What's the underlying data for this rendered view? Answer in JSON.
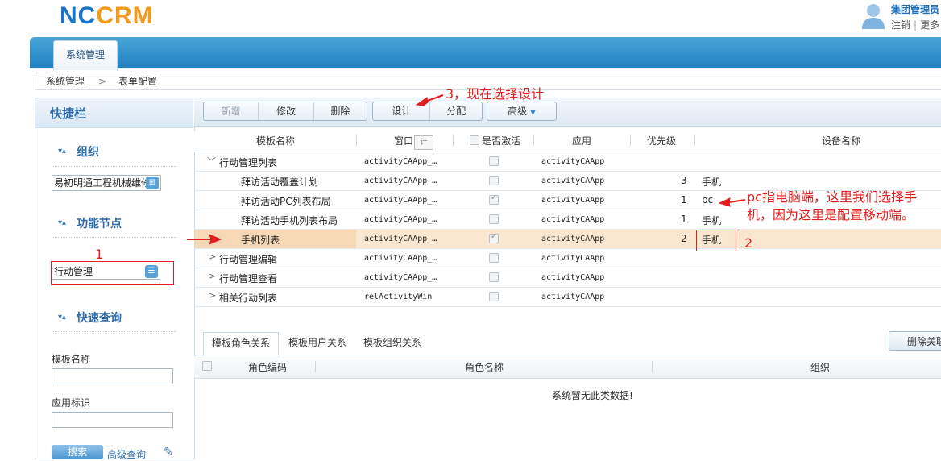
{
  "header": {
    "logo_nc": "NC",
    "logo_crm": "CRM",
    "user_name": "集团管理员",
    "logout": "注销",
    "more": "更多"
  },
  "nav": {
    "tab": "系统管理"
  },
  "breadcrumb": {
    "level1": "系统管理",
    "separator": ">",
    "level2": "表单配置"
  },
  "sidebar": {
    "title": "快捷栏",
    "org": {
      "title": "组织",
      "value": "易初明通工程机械维修"
    },
    "func": {
      "title": "功能节点",
      "value": "行动管理"
    },
    "query": {
      "title": "快速查询",
      "template_label": "模板名称",
      "app_label": "应用标识",
      "search_button": "搜索",
      "advanced_link": "高级查询"
    }
  },
  "toolbar": {
    "new": "新增",
    "edit": "修改",
    "delete": "删除",
    "design": "设计",
    "assign": "分配",
    "advanced": "高级"
  },
  "grid": {
    "headers": {
      "name": "模板名称",
      "window": "窗口",
      "active": "是否激活",
      "app": "应用",
      "priority": "优先级",
      "device": "设备名称"
    },
    "window_tooltip": "计",
    "rows": [
      {
        "name": "行动管理列表",
        "window": "activityCAApp_…",
        "active": false,
        "app": "activityCAApp",
        "priority": "",
        "device": "",
        "expand": "﹀",
        "level": 0
      },
      {
        "name": "拜访活动覆盖计划",
        "window": "activityCAApp_…",
        "active": false,
        "app": "activityCAApp",
        "priority": "3",
        "device": "手机",
        "expand": "",
        "level": 1
      },
      {
        "name": "拜访活动PC列表布局",
        "window": "activityCAApp_…",
        "active": true,
        "app": "activityCAApp",
        "priority": "1",
        "device": "pc",
        "expand": "",
        "level": 1
      },
      {
        "name": "拜访活动手机列表布局",
        "window": "activityCAApp_…",
        "active": false,
        "app": "activityCAApp",
        "priority": "1",
        "device": "手机",
        "expand": "",
        "level": 1
      },
      {
        "name": "手机列表",
        "window": "activityCAApp_…",
        "active": true,
        "app": "activityCAApp",
        "priority": "2",
        "device": "手机",
        "expand": "",
        "level": 1
      },
      {
        "name": "行动管理编辑",
        "window": "activityCAApp_…",
        "active": false,
        "app": "activityCAApp",
        "priority": "",
        "device": "",
        "expand": ">",
        "level": 0
      },
      {
        "name": "行动管理查看",
        "window": "activityCAApp_…",
        "active": false,
        "app": "activityCAApp",
        "priority": "",
        "device": "",
        "expand": ">",
        "level": 0
      },
      {
        "name": "相关行动列表",
        "window": "relActivityWin",
        "active": false,
        "app": "activityCAApp",
        "priority": "",
        "device": "",
        "expand": ">",
        "level": 0
      }
    ]
  },
  "lower": {
    "tabs": [
      "模板角色关系",
      "模板用户关系",
      "模板组织关系"
    ],
    "delete_button": "删除关联",
    "headers": {
      "code": "角色编码",
      "name": "角色名称",
      "org": "组织"
    },
    "empty": "系统暂无此类数据!"
  },
  "annotations": {
    "step1": "1",
    "step2": "2",
    "step3": "3，现在选择设计",
    "pc_note": "pc指电脑端，这里我们选择手机，因为这里是配置移动端。"
  },
  "colors": {
    "brand_blue": "#1a73c9",
    "brand_orange": "#f29a1b",
    "annotation_red": "#e02020",
    "selected_row": "#fbe6cf"
  }
}
